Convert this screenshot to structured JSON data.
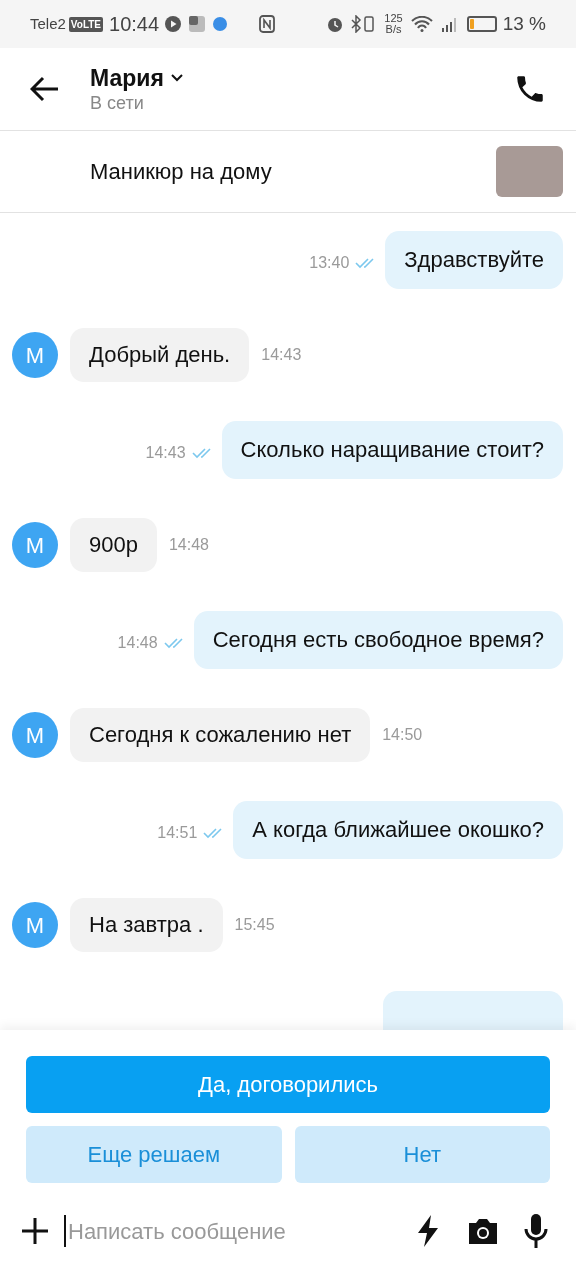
{
  "status_bar": {
    "carrier": "Tele2",
    "volte": "VoLTE",
    "time": "10:44",
    "speed_value": "125",
    "speed_unit": "B/s",
    "battery": "13 %"
  },
  "header": {
    "name": "Мария",
    "status": "В сети"
  },
  "listing": {
    "title": "Маникюр на дому"
  },
  "messages": [
    {
      "kind": "out",
      "text": "Здравствуйте",
      "time": "13:40",
      "read": true
    },
    {
      "kind": "in",
      "avatar": "М",
      "text": "Добрый день.",
      "time": "14:43"
    },
    {
      "kind": "out",
      "text": "Сколько наращивание стоит?",
      "time": "14:43",
      "read": true
    },
    {
      "kind": "in",
      "avatar": "М",
      "text": "900р",
      "time": "14:48"
    },
    {
      "kind": "out",
      "text": "Сегодня есть свободное время?",
      "time": "14:48",
      "read": true
    },
    {
      "kind": "in",
      "avatar": "М",
      "text": "Сегодня к сожалению нет",
      "time": "14:50"
    },
    {
      "kind": "out",
      "text": "А когда ближайшее окошко?",
      "time": "14:51",
      "read": true
    },
    {
      "kind": "in",
      "avatar": "М",
      "text": "На завтра .",
      "time": "15:45"
    },
    {
      "kind": "out-hidden"
    }
  ],
  "quick_replies": [
    {
      "label": "Да, договорились",
      "kind": "primary"
    },
    {
      "label": "Еще решаем",
      "kind": "secondary"
    },
    {
      "label": "Нет",
      "kind": "secondary"
    }
  ],
  "composer": {
    "placeholder": "Написать сообщение"
  }
}
